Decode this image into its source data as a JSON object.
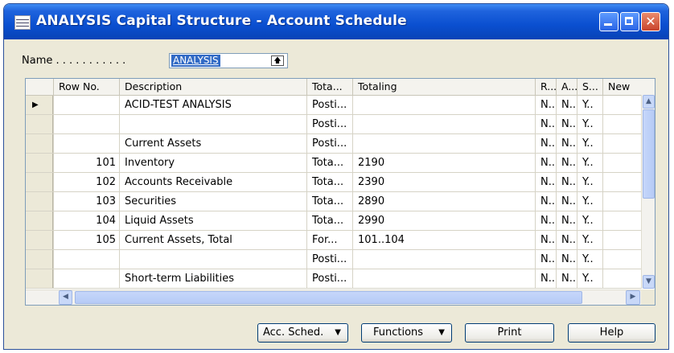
{
  "window": {
    "title": "ANALYSIS Capital Structure - Account Schedule",
    "icon": "grid-table-icon",
    "controls": [
      "minimize-icon",
      "maximize-icon",
      "close-icon"
    ],
    "close_glyph": "✕"
  },
  "name_field": {
    "label": "Name . . . . . . . . . . .",
    "value": "ANALYSIS",
    "lookup_glyph": "🡅"
  },
  "grid": {
    "columns": [
      "Row No.",
      "Description",
      "Tota...",
      "Totaling",
      "R...",
      "A...",
      "S...",
      "New"
    ],
    "current_row_marker": "▶",
    "rows": [
      {
        "row_no": "",
        "description": "ACID-TEST ANALYSIS",
        "type": "Posti...",
        "totaling": "",
        "r": "N..",
        "a": "N..",
        "s": "Y.."
      },
      {
        "row_no": "",
        "description": "",
        "type": "Posti...",
        "totaling": "",
        "r": "N..",
        "a": "N..",
        "s": "Y.."
      },
      {
        "row_no": "",
        "description": "Current Assets",
        "type": "Posti...",
        "totaling": "",
        "r": "N..",
        "a": "N..",
        "s": "Y.."
      },
      {
        "row_no": "101",
        "description": "Inventory",
        "type": "Tota...",
        "totaling": "2190",
        "r": "N..",
        "a": "N..",
        "s": "Y.."
      },
      {
        "row_no": "102",
        "description": "Accounts Receivable",
        "type": "Tota...",
        "totaling": "2390",
        "r": "N..",
        "a": "N..",
        "s": "Y.."
      },
      {
        "row_no": "103",
        "description": "Securities",
        "type": "Tota...",
        "totaling": "2890",
        "r": "N..",
        "a": "N..",
        "s": "Y.."
      },
      {
        "row_no": "104",
        "description": "Liquid Assets",
        "type": "Tota...",
        "totaling": "2990",
        "r": "N..",
        "a": "N..",
        "s": "Y.."
      },
      {
        "row_no": "105",
        "description": "Current Assets, Total",
        "type": "For...",
        "totaling": "101..104",
        "r": "N..",
        "a": "N..",
        "s": "Y.."
      },
      {
        "row_no": "",
        "description": "",
        "type": "Posti...",
        "totaling": "",
        "r": "N..",
        "a": "N..",
        "s": "Y.."
      },
      {
        "row_no": "",
        "description": "Short-term Liabilities",
        "type": "Posti...",
        "totaling": "",
        "r": "N..",
        "a": "N..",
        "s": "Y.."
      }
    ],
    "scroll": {
      "up": "▲",
      "down": "▼",
      "left": "◀",
      "right": "▶"
    }
  },
  "buttons": {
    "acc_sched": "Acc. Sched.",
    "functions": "Functions",
    "print": "Print",
    "help": "Help",
    "dropdown_glyph": "▼"
  },
  "colors": {
    "titlebar": "#0a4fd0",
    "selection": "#316ac5",
    "window_bg": "#ece9d8"
  }
}
